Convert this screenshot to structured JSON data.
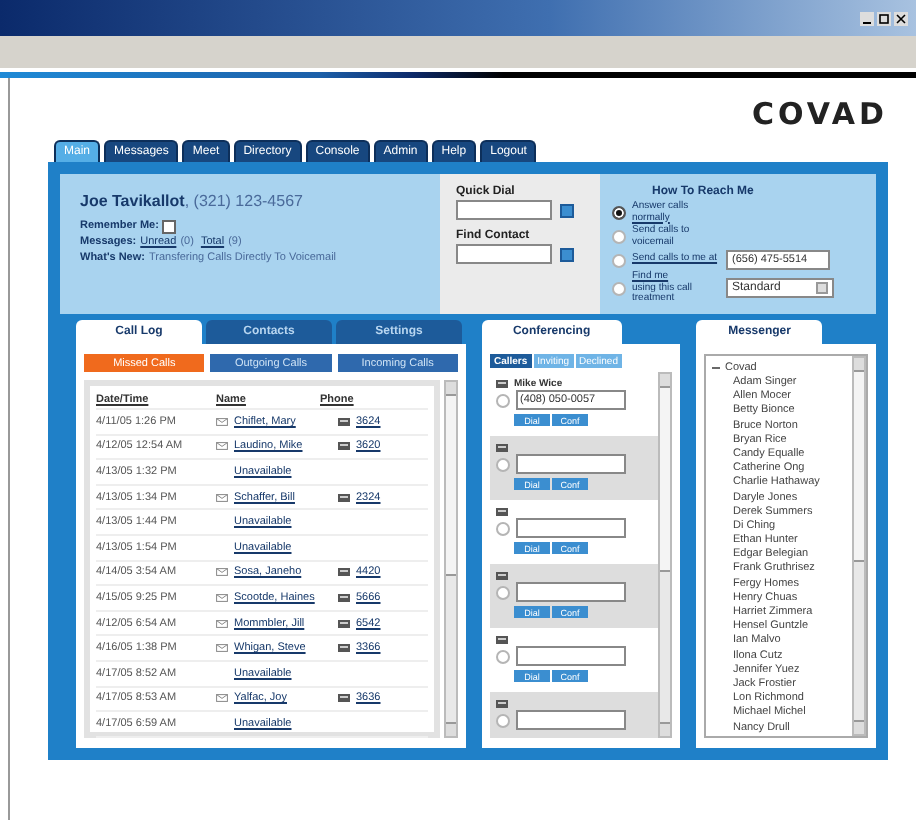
{
  "logo": "COVAD",
  "tabs": [
    {
      "label": "Main",
      "selected": true
    },
    {
      "label": "Messages",
      "selected": false
    },
    {
      "label": "Meet",
      "selected": false
    },
    {
      "label": "Directory",
      "selected": false
    },
    {
      "label": "Console",
      "selected": false
    },
    {
      "label": "Admin",
      "selected": false
    },
    {
      "label": "Help",
      "selected": false
    },
    {
      "label": "Logout",
      "selected": false
    }
  ],
  "user": {
    "name": "Joe Tavikallot",
    "phone": ", (321) 123-4567",
    "remember_label": "Remember Me:",
    "remember": false,
    "messages_label": "Messages:",
    "messages": [
      {
        "text": "Unread",
        "link": true
      },
      {
        "text": "(0) ",
        "link": false
      },
      {
        "text": "Total",
        "link": true
      },
      {
        "text": "(9)",
        "link": false
      }
    ],
    "news_label": "What's New:",
    "news": "Transfering Calls Directly To Voicemail"
  },
  "quick_dial": {
    "label": "Quick Dial"
  },
  "find_contact": {
    "label": "Find Contact"
  },
  "reach": {
    "title": "How To Reach Me",
    "options": [
      {
        "kind": "plain",
        "selected": true,
        "parts": [
          {
            "text": "Answer calls ",
            "link": false
          },
          {
            "text": "normally",
            "link": true
          }
        ]
      },
      {
        "kind": "plain",
        "selected": false,
        "parts": [
          {
            "text": "Send calls to voicemail",
            "link": false
          }
        ]
      },
      {
        "kind": "field",
        "selected": false,
        "parts": [
          {
            "text": "Send calls to me at",
            "link": true
          }
        ],
        "value": "(656) 475-5514"
      },
      {
        "kind": "select",
        "selected": false,
        "parts": [
          {
            "text": "Find me",
            "link": true
          },
          {
            "text": " using this call treatment",
            "link": false
          }
        ],
        "value": "Standard"
      }
    ]
  },
  "call_log": {
    "tabs": [
      {
        "label": "Call Log",
        "selected": true
      },
      {
        "label": "Contacts",
        "selected": false
      },
      {
        "label": "Settings",
        "selected": false
      }
    ],
    "subtabs": [
      {
        "label": "Missed Calls",
        "selected": true
      },
      {
        "label": "Outgoing Calls",
        "selected": false
      },
      {
        "label": "Incoming Calls",
        "selected": false
      }
    ],
    "columns": [
      "Date/Time",
      "Name",
      "Phone"
    ],
    "rows": [
      {
        "kind": "contact",
        "date": "4/11/05 1:26 PM",
        "name": "Chiflet, Mary",
        "phone": "3624"
      },
      {
        "kind": "contact",
        "date": "4/12/05 12:54 AM",
        "name": "Laudino, Mike",
        "phone": "3620"
      },
      {
        "kind": "unavailable",
        "date": "4/13/05 1:32 PM",
        "name": "Unavailable"
      },
      {
        "kind": "contact",
        "date": "4/13/05 1:34 PM",
        "name": "Schaffer, Bill",
        "phone": "2324"
      },
      {
        "kind": "unavailable",
        "date": "4/13/05 1:44 PM",
        "name": "Unavailable"
      },
      {
        "kind": "unavailable",
        "date": "4/13/05 1:54 PM",
        "name": "Unavailable"
      },
      {
        "kind": "contact",
        "date": "4/14/05 3:54 AM",
        "name": "Sosa, Janeho",
        "phone": "4420"
      },
      {
        "kind": "contact",
        "date": "4/15/05 9:25 PM",
        "name": "Scootde, Haines",
        "phone": "5666"
      },
      {
        "kind": "contact",
        "date": "4/12/05 6:54 AM",
        "name": "Mommbler, Jill",
        "phone": "6542"
      },
      {
        "kind": "contact",
        "date": "4/16/05 1:38 PM",
        "name": "Whigan, Steve",
        "phone": "3366"
      },
      {
        "kind": "unavailable",
        "date": "4/17/05 8:52 AM",
        "name": "Unavailable"
      },
      {
        "kind": "contact",
        "date": "4/17/05 8:53 AM",
        "name": "Yalfac, Joy",
        "phone": "3636"
      },
      {
        "kind": "unavailable",
        "date": "4/17/05 6:59 AM",
        "name": "Unavailable"
      }
    ]
  },
  "conferencing": {
    "tab": "Conferencing",
    "subtabs": [
      {
        "label": "Callers",
        "selected": true
      },
      {
        "label": "Inviting",
        "selected": false
      },
      {
        "label": "Declined",
        "selected": false
      }
    ],
    "slots": [
      {
        "name": "Mike Wice",
        "number": "(408) 050-0057",
        "selected": false,
        "buttons": [
          "Dial",
          "Conf"
        ]
      },
      {
        "selected": false,
        "buttons": [
          "Dial",
          "Conf"
        ]
      },
      {
        "selected": false,
        "buttons": [
          "Dial",
          "Conf"
        ]
      },
      {
        "selected": false,
        "buttons": [
          "Dial",
          "Conf"
        ]
      },
      {
        "selected": false,
        "buttons": [
          "Dial",
          "Conf"
        ]
      },
      {
        "selected": false
      }
    ]
  },
  "messenger": {
    "tab": "Messenger",
    "group": {
      "label": "Covad",
      "expanded": true,
      "children": [
        "Adam Singer",
        "Allen Mocer",
        "Betty Bionce",
        "Bruce Norton",
        "Bryan Rice",
        "Candy Equalle",
        "Catherine Ong",
        "Charlie Hathaway",
        "Daryle Jones",
        "Derek Summers",
        "Di Ching",
        "Ethan Hunter",
        "Edgar Belegian",
        "Frank Gruthrisez",
        "Fergy Homes",
        "Henry Chuas",
        "Harriet Zimmera",
        "Hensel Guntzle",
        "Ian Malvo",
        "Ilona Cutz",
        "Jennifer Yuez",
        "Jack Frostier",
        "Lon Richmond",
        "Michael Michel",
        "Nancy Drull"
      ]
    }
  }
}
